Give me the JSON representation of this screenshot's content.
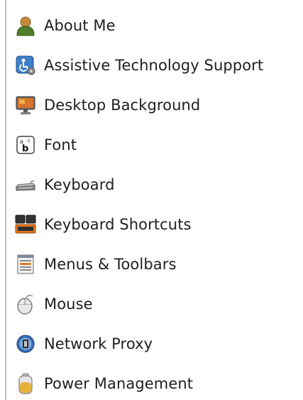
{
  "menu": {
    "items": [
      {
        "label": "About Me",
        "icon": "person-icon"
      },
      {
        "label": "Assistive Technology Support",
        "icon": "accessibility-icon"
      },
      {
        "label": "Desktop Background",
        "icon": "monitor-icon"
      },
      {
        "label": "Font",
        "icon": "font-icon"
      },
      {
        "label": "Keyboard",
        "icon": "keyboard-icon"
      },
      {
        "label": "Keyboard Shortcuts",
        "icon": "keyboard-shortcuts-icon"
      },
      {
        "label": "Menus & Toolbars",
        "icon": "menus-toolbars-icon"
      },
      {
        "label": "Mouse",
        "icon": "mouse-icon"
      },
      {
        "label": "Network Proxy",
        "icon": "network-proxy-icon"
      },
      {
        "label": "Power Management",
        "icon": "battery-icon"
      }
    ]
  }
}
